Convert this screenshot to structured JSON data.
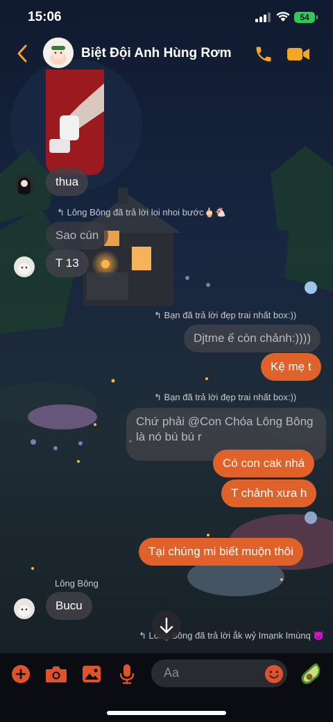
{
  "status_bar": {
    "time": "15:06",
    "battery": "54"
  },
  "header": {
    "title": "Biệt Đội Anh Hùng Rơm",
    "back_icon": "chevron-left-icon",
    "call_icon": "phone-icon",
    "video_icon": "video-camera-icon"
  },
  "colors": {
    "accent": "#f5a623",
    "outgoing": "#e0622a",
    "incoming": "#424248"
  },
  "messages": {
    "m1": "thua",
    "reply1": "Lông Bông đã trả lời loi nhoi bước🖕🏻🐔",
    "m2_quoted": "Sao cún",
    "m2": "T 13",
    "reply2": "Bạn đã trả lời đẹp trai nhất box:))",
    "m3_quoted": "Djtme ế còn chảnh:))))",
    "m3": "Kệ mẹ t",
    "reply3": "Bạn đã trả lời đẹp trai nhất box:))",
    "m4_quoted_line1": "Chứ phải @Con Chóa Lông Bông",
    "m4_quoted_line2": "là nó bú bú r",
    "m4": "Có con cak nhá",
    "m5": "T chảnh xưa h",
    "m6": "Tại chúng mi biết muộn thôi",
    "sender_name": "Lông Bông",
    "m7": "Bucu",
    "reply4": "Lông Bông đã trả lời ắk wỷ Imạnk Imùnq 👿"
  },
  "composer": {
    "placeholder": "Aa"
  }
}
